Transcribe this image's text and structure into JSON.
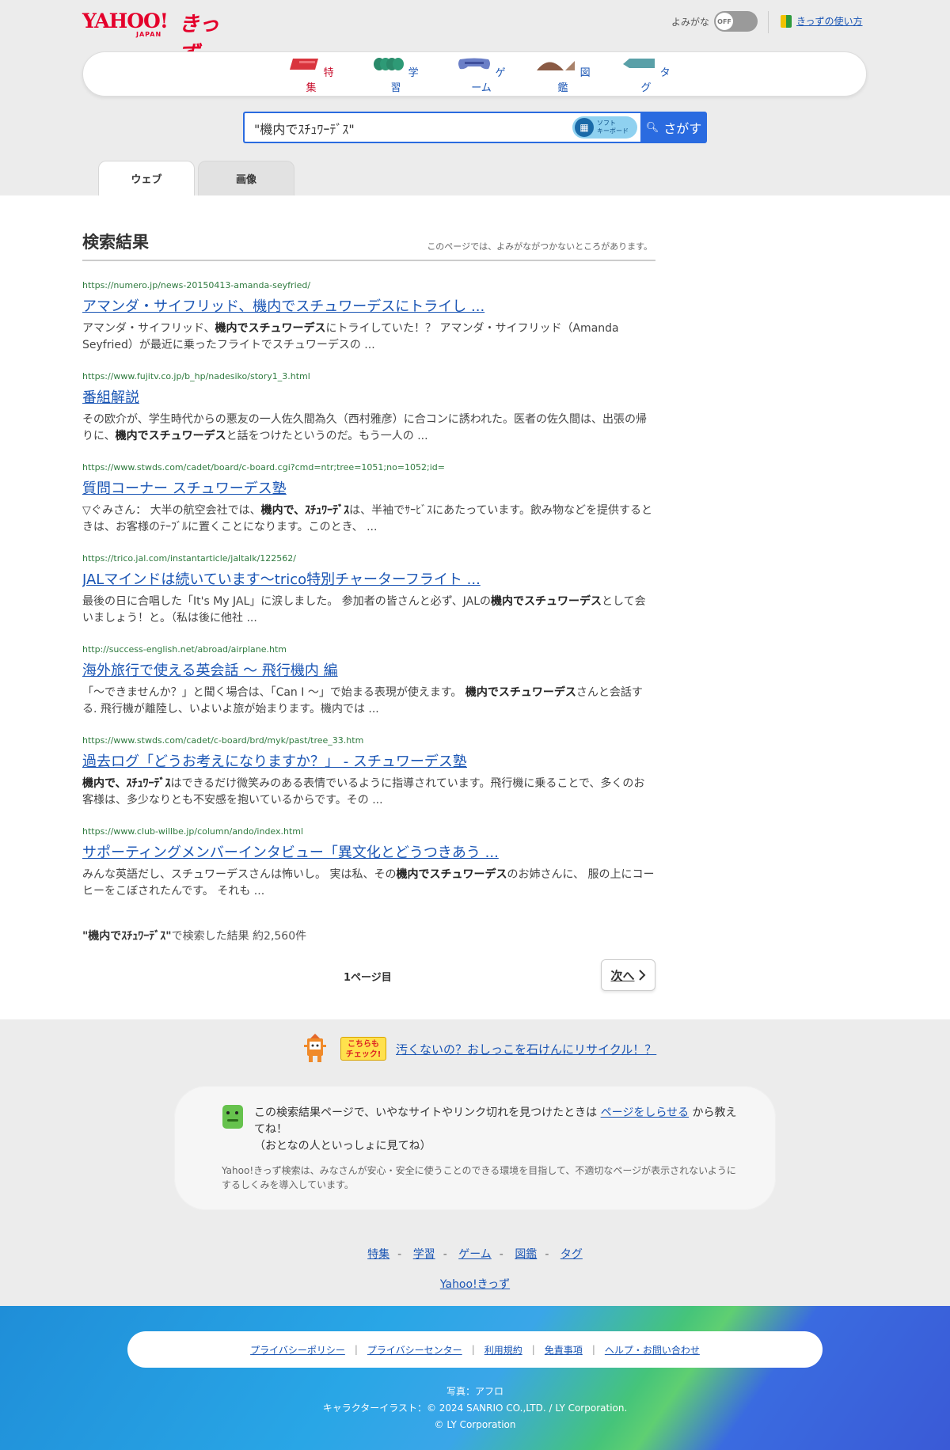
{
  "header": {
    "logo_main": "YAHOO!",
    "logo_sub": "JAPAN",
    "logo_kids": "きっず",
    "yomigana_label": "よみがな",
    "toggle_state": "OFF",
    "howto_link": "きっずの使い方"
  },
  "nav": {
    "items": [
      {
        "label": "特集",
        "color": "#c8102e"
      },
      {
        "label": "学習",
        "color": "#2a8a6a"
      },
      {
        "label": "ゲーム",
        "color": "#6b7fc7"
      },
      {
        "label": "図鑑",
        "color": "#8a5a44"
      },
      {
        "label": "タグ",
        "color": "#5aa0a8"
      }
    ]
  },
  "search": {
    "query": "\"機内でｽﾁｭﾜｰﾃﾞｽ\"",
    "softkb_line1": "ソフト",
    "softkb_line2": "キーボード",
    "button": "さがす"
  },
  "tabs": {
    "web": "ウェブ",
    "image": "画像"
  },
  "results_header": {
    "title": "検索結果",
    "note": "このページでは、よみがながつかないところがあります。"
  },
  "results": [
    {
      "url": "https://numero.jp/news-20150413-amanda-seyfried/",
      "title": "アマンダ・サイフリッド、機内でスチュワーデスにトライし ...",
      "desc": [
        {
          "t": "アマンダ・サイフリッド、",
          "b": false
        },
        {
          "t": "機内でスチュワーデス",
          "b": true
        },
        {
          "t": "にトライしていた！？ アマンダ・サイフリッド（Amanda Seyfried）が最近に乗ったフライトでスチュワーデスの ...",
          "b": false
        }
      ]
    },
    {
      "url": "https://www.fujitv.co.jp/b_hp/nadesiko/story1_3.html",
      "title": "番組解説",
      "desc": [
        {
          "t": "その欧介が、学生時代からの悪友の一人佐久間為久（西村雅彦）に合コンに誘われた。医者の佐久間は、出張の帰りに、",
          "b": false
        },
        {
          "t": "機内でスチュワーデス",
          "b": true
        },
        {
          "t": "と話をつけたというのだ。もう一人の ...",
          "b": false
        }
      ]
    },
    {
      "url": "https://www.stwds.com/cadet/board/c-board.cgi?cmd=ntr;tree=1051;no=1052;id=",
      "title": "質問コーナー スチュワーデス塾",
      "desc": [
        {
          "t": "▽ぐみさん： 大半の航空会社では、",
          "b": false
        },
        {
          "t": "機内で、ｽﾁｭﾜｰﾃﾞｽ",
          "b": true
        },
        {
          "t": "は、半袖でｻｰﾋﾞｽにあたっています。飲み物などを提供するときは、お客様のﾃｰﾌﾞﾙに置くことになります。このとき、 ...",
          "b": false
        }
      ]
    },
    {
      "url": "https://trico.jal.com/instantarticle/jaltalk/122562/",
      "title": "JALマインドは続いています〜trico特別チャーターフライト ...",
      "desc": [
        {
          "t": "最後の日に合唱した「It's My JAL」に涙しました。 参加者の皆さんと必ず、JALの",
          "b": false
        },
        {
          "t": "機内でスチュワーデス",
          "b": true
        },
        {
          "t": "として会いましょう！と。（私は後に他社 ...",
          "b": false
        }
      ]
    },
    {
      "url": "http://success-english.net/abroad/airplane.htm",
      "title": "海外旅行で使える英会話 〜 飛行機内 編",
      "desc": [
        {
          "t": "「〜できませんか？」と聞く場合は、「Can I 〜」で始まる表現が使えます。 ",
          "b": false
        },
        {
          "t": "機内でスチュワーデス",
          "b": true
        },
        {
          "t": "さんと会話する. 飛行機が離陸し、いよいよ旅が始まります。機内では ...",
          "b": false
        }
      ]
    },
    {
      "url": "https://www.stwds.com/cadet/c-board/brd/myk/past/tree_33.htm",
      "title": "過去ログ「どうお考えになりますか？」 - スチュワーデス塾",
      "desc": [
        {
          "t": "機内で、ｽﾁｭﾜｰﾃﾞｽ",
          "b": true
        },
        {
          "t": "はできるだけ微笑みのある表情でいるように指導されています。飛行機に乗ることで、多くのお客様は、多少なりとも不安感を抱いているからです。その ...",
          "b": false
        }
      ]
    },
    {
      "url": "https://www.club-willbe.jp/column/ando/index.html",
      "title": "サポーティングメンバーインタビュー「異文化とどうつきあう ...",
      "desc": [
        {
          "t": "みんな英語だし、スチュワーデスさんは怖いし。 実は私、その",
          "b": false
        },
        {
          "t": "機内でスチュワーデス",
          "b": true
        },
        {
          "t": "のお姉さんに、 服の上にコーヒーをこぼされたんです。 それも ...",
          "b": false
        }
      ]
    }
  ],
  "count": {
    "query": "\"機内でｽﾁｭﾜｰﾃﾞｽ\"",
    "text": "で検索した結果 約2,560件"
  },
  "pager": {
    "current": "1ページ目",
    "next": "次へ"
  },
  "promo": {
    "badge_line1": "こちらも",
    "badge_line2": "チェック!",
    "link": "汚くないの？おしっこを石けんにリサイクル！？"
  },
  "report": {
    "text_before": "この検索結果ページで、いやなサイトやリンク切れを見つけたときは ",
    "link": "ページをしらせる",
    "text_after": " から教えてね！",
    "text_line2": "（おとなの人といっしょに見てね）",
    "note": "Yahoo!きっず検索は、みなさんが安心・安全に使うことのできる環境を目指して、不適切なページが表示されないようにするしくみを導入しています。"
  },
  "footer": {
    "links": [
      "特集",
      "学習",
      "ゲーム",
      "図鑑",
      "タグ"
    ],
    "separator": "-",
    "brand": "Yahoo!きっず",
    "legal": [
      "プライバシーポリシー",
      "プライバシーセンター",
      "利用規約",
      "免責事項",
      "ヘルプ・お問い合わせ"
    ],
    "legal_separator": "|",
    "credit1": "写真：アフロ",
    "credit2": "キャラクターイラスト：© 2024 SANRIO CO.,LTD. / LY Corporation.",
    "credit3": "© LY Corporation"
  }
}
